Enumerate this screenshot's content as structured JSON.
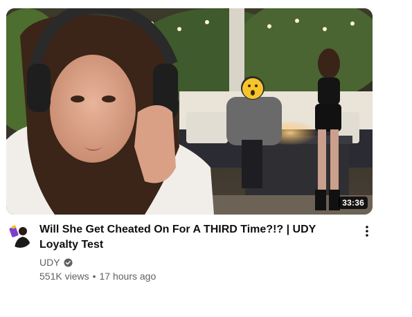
{
  "video": {
    "title": "Will She Get Cheated On For A THIRD Time?!? | UDY Loyalty Test",
    "duration": "33:36",
    "views": "551K views",
    "separator": "•",
    "age": "17 hours ago"
  },
  "channel": {
    "name": "UDY",
    "verified": true
  },
  "icons": {
    "verified": "verified-check-icon",
    "menu": "more-vert-icon"
  },
  "colors": {
    "title": "#0f0f0f",
    "secondary_text": "#606060",
    "duration_bg": "#000000",
    "duration_text": "#ffffff"
  }
}
